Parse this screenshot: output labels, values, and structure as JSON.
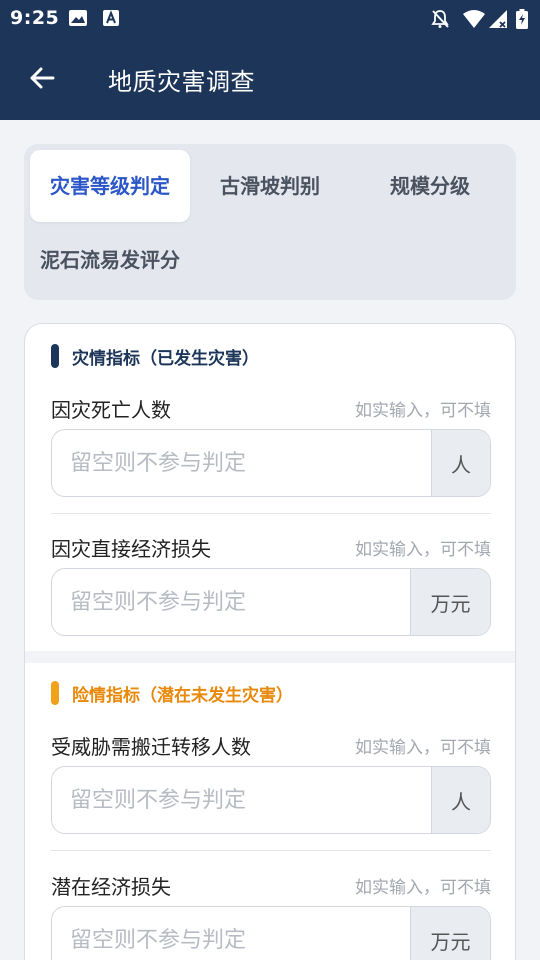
{
  "status_bar": {
    "time": "9:25"
  },
  "header": {
    "title": "地质灾害调查"
  },
  "tabs": [
    {
      "label": "灾害等级判定",
      "active": true
    },
    {
      "label": "古滑坡判别",
      "active": false
    },
    {
      "label": "规模分级",
      "active": false
    },
    {
      "label": "泥石流易发评分",
      "active": false
    }
  ],
  "sections": [
    {
      "title": "灾情指标（已发生灾害）",
      "accent": "#1c3559",
      "fields": [
        {
          "label": "因灾死亡人数",
          "hint": "如实输入，可不填",
          "placeholder": "留空则不参与判定",
          "unit": "人"
        },
        {
          "label": "因灾直接经济损失",
          "hint": "如实输入，可不填",
          "placeholder": "留空则不参与判定",
          "unit": "万元"
        }
      ]
    },
    {
      "title": "险情指标（潜在未发生灾害）",
      "accent": "#e8890c",
      "fields": [
        {
          "label": "受威胁需搬迁转移人数",
          "hint": "如实输入，可不填",
          "placeholder": "留空则不参与判定",
          "unit": "人"
        },
        {
          "label": "潜在经济损失",
          "hint": "如实输入，可不填",
          "placeholder": "留空则不参与判定",
          "unit": "万元"
        }
      ]
    }
  ]
}
